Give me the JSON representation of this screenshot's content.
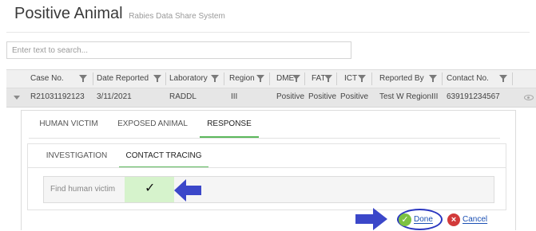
{
  "app": {
    "title": "Positive Animal",
    "subtitle": "Rabies Data Share System"
  },
  "search": {
    "placeholder": "Enter text to search..."
  },
  "grid": {
    "columns": [
      "Case No.",
      "Date Reported",
      "Laboratory",
      "Region",
      "DME",
      "FAT",
      "ICT",
      "Reported By",
      "Contact No."
    ],
    "row": [
      "R21031192123",
      "3/11/2021",
      "RADDL",
      "III",
      "Positive",
      "Positive",
      "Positive",
      "Test W RegionIII",
      "639191234567"
    ]
  },
  "tabs": {
    "items": [
      "HUMAN VICTIM",
      "EXPOSED ANIMAL",
      "RESPONSE"
    ],
    "active": "RESPONSE"
  },
  "subtabs": {
    "items": [
      "INVESTIGATION",
      "CONTACT TRACING"
    ],
    "active": "CONTACT TRACING"
  },
  "form": {
    "find_human_victim_label": "Find human victim",
    "find_human_victim_checked": true,
    "checkmark_glyph": "✓"
  },
  "actions": {
    "done_label": "Done",
    "cancel_label": "Cancel"
  },
  "colors": {
    "accent_green": "#5cb85c",
    "checkbox_cell": "#d6f3cc",
    "annotation_arrow": "#3b47c9",
    "link_blue": "#1a4fb3"
  }
}
